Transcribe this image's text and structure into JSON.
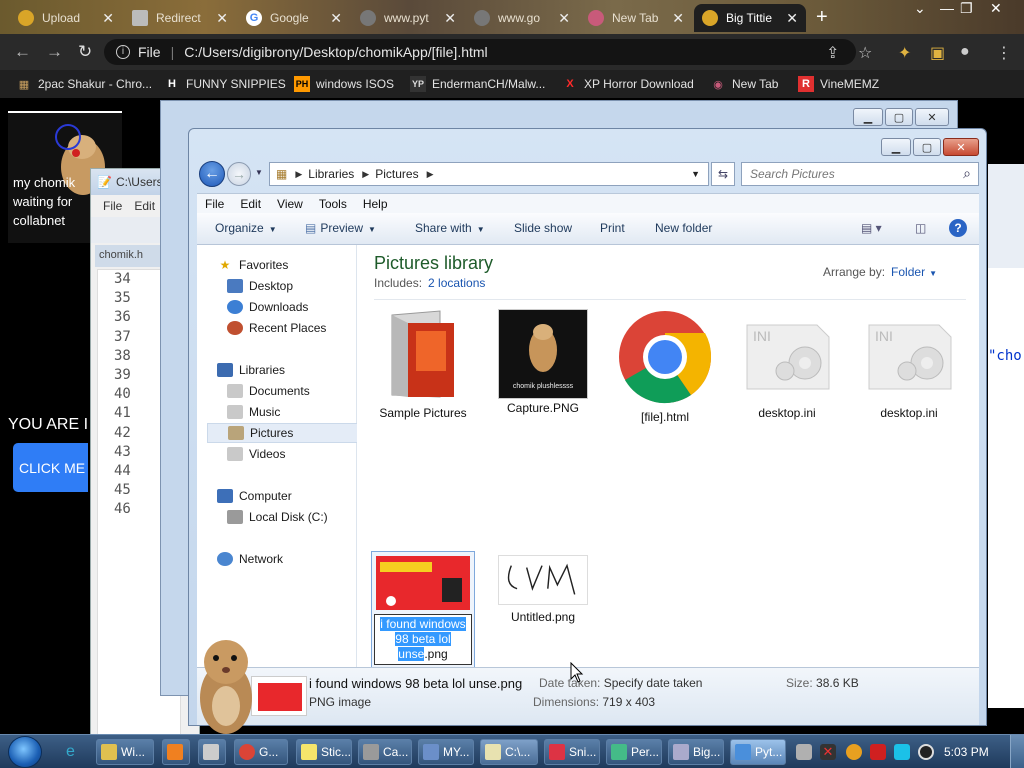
{
  "browser": {
    "tabs": [
      {
        "title": "Upload",
        "color": "#d9a528"
      },
      {
        "title": "Redirect",
        "color": "#cccccc"
      },
      {
        "title": "Google",
        "color": "#4285f4"
      },
      {
        "title": "www.pyt",
        "color": "#888888"
      },
      {
        "title": "www.go",
        "color": "#888888"
      },
      {
        "title": "New Tab",
        "color": "#c85a7a"
      },
      {
        "title": "Big Tittie",
        "color": "#d9a528"
      }
    ],
    "url_label": "File",
    "url": "C:/Users/digibrony/Desktop/chomikApp/[file].html",
    "bookmarks": [
      {
        "label": "2pac Shakur - Chro...",
        "icon": "2pac-icon",
        "glyph": "▦",
        "color": "#c9a060"
      },
      {
        "label": "FUNNY SNIPPIES",
        "icon": "h-icon",
        "glyph": "H",
        "color": "#ffffff"
      },
      {
        "label": "windows ISOS",
        "icon": "ph-icon",
        "glyph": "PH",
        "color": "#ff9900"
      },
      {
        "label": "EndermanCH/Malw...",
        "icon": "yp-icon",
        "glyph": "YP",
        "color": "#cccccc"
      },
      {
        "label": "XP Horror Download",
        "icon": "x-icon",
        "glyph": "X",
        "color": "#ff2a2a"
      },
      {
        "label": "New Tab",
        "icon": "newtab-icon",
        "glyph": "◉",
        "color": "#c85a7a"
      },
      {
        "label": "VineMEMZ",
        "icon": "r-icon",
        "glyph": "R",
        "color": "#e03030"
      }
    ]
  },
  "webpage": {
    "caption": "my chomik waiting for collabnet",
    "you_are": "YOU ARE I",
    "click_me": "CLICK ME !"
  },
  "editor": {
    "title": "C:\\Users",
    "menu": [
      "File",
      "Edit"
    ],
    "tab": "chomik.h",
    "line_numbers": [
      "34",
      "35",
      "36",
      "37",
      "38",
      "39",
      "40",
      "41",
      "42",
      "43",
      "44",
      "45",
      "46"
    ],
    "code_fragment": "\"cho"
  },
  "explorer": {
    "breadcrumb": [
      "Libraries",
      "Pictures"
    ],
    "search_placeholder": "Search Pictures",
    "menu": [
      "File",
      "Edit",
      "View",
      "Tools",
      "Help"
    ],
    "commands": [
      "Organize",
      "Preview",
      "Share with",
      "Slide show",
      "Print",
      "New folder"
    ],
    "nav": {
      "favorites": "Favorites",
      "favorites_items": [
        "Desktop",
        "Downloads",
        "Recent Places"
      ],
      "libraries": "Libraries",
      "libraries_items": [
        "Documents",
        "Music",
        "Pictures",
        "Videos"
      ],
      "computer": "Computer",
      "computer_items": [
        "Local Disk (C:)"
      ],
      "network": "Network"
    },
    "library_title": "Pictures library",
    "includes_label": "Includes:",
    "includes_link": "2 locations",
    "arrange_label": "Arrange by:",
    "arrange_value": "Folder",
    "files": [
      {
        "name": "Sample Pictures"
      },
      {
        "name": "Capture.PNG",
        "thumb_text": "chomik plushlessss"
      },
      {
        "name": "[file].html"
      },
      {
        "name": "desktop.ini"
      },
      {
        "name": "desktop.ini"
      },
      {
        "name_selected": "i found windows 98 beta lol unse",
        "name_rest": ".png"
      },
      {
        "name": "Untitled.png"
      }
    ],
    "details": {
      "filename": "i found windows 98 beta lol unse.png",
      "type": "PNG image",
      "date_label": "Date taken:",
      "date_value": "Specify date taken",
      "dim_label": "Dimensions:",
      "dim_value": "719 x 403",
      "size_label": "Size:",
      "size_value": "38.6 KB"
    }
  },
  "taskbar": {
    "items": [
      "Wi...",
      "",
      "",
      "G...",
      "Stic...",
      "Ca...",
      "MY...",
      "C:\\...",
      "Sni...",
      "Per...",
      "Big...",
      "Pyt..."
    ],
    "clock": "5:03 PM"
  }
}
